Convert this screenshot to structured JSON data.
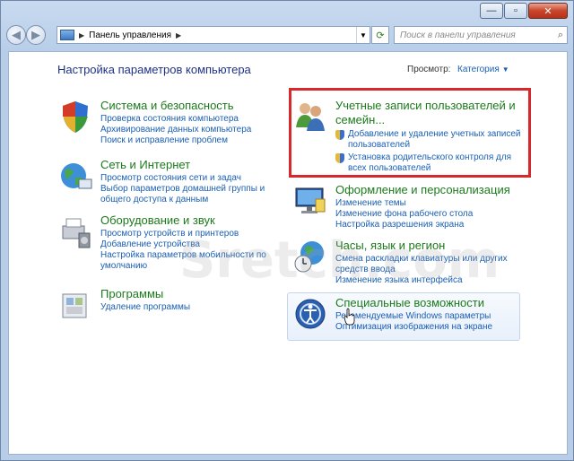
{
  "window": {
    "controls": {
      "minimize": "—",
      "maximize": "▫",
      "close": "✕"
    }
  },
  "navbar": {
    "breadcrumb": "Панель управления",
    "search_placeholder": "Поиск в панели управления"
  },
  "header": {
    "title": "Настройка параметров компьютера",
    "view_label": "Просмотр:",
    "view_value": "Категория"
  },
  "categories": {
    "system": {
      "title": "Система и безопасность",
      "links": [
        "Проверка состояния компьютера",
        "Архивирование данных компьютера",
        "Поиск и исправление проблем"
      ]
    },
    "network": {
      "title": "Сеть и Интернет",
      "links": [
        "Просмотр состояния сети и задач",
        "Выбор параметров домашней группы и",
        "общего доступа к данным"
      ]
    },
    "hardware": {
      "title": "Оборудование и звук",
      "links": [
        "Просмотр устройств и принтеров",
        "Добавление устройства",
        "Настройка параметров мобильности по",
        "умолчанию"
      ]
    },
    "programs": {
      "title": "Программы",
      "links": [
        "Удаление программы"
      ]
    },
    "accounts": {
      "title_line1": "Учетные записи пользователей и",
      "title_line2": "семейн...",
      "links": [
        "Добавление и удаление учетных записей",
        "пользователей",
        "Установка родительского контроля для",
        "всех пользователей"
      ]
    },
    "appearance": {
      "title": "Оформление и персонализация",
      "links": [
        "Изменение темы",
        "Изменение фона рабочего стола",
        "Настройка разрешения экрана"
      ]
    },
    "clock": {
      "title": "Часы, язык и регион",
      "links": [
        "Смена раскладки клавиатуры или других",
        "средств ввода",
        "Изменение языка интерфейса"
      ]
    },
    "access": {
      "title": "Специальные возможности",
      "links": [
        "Рекомендуемые Windows параметры",
        "Оптимизация изображения на экране"
      ]
    }
  },
  "watermark": "Sretch.com",
  "colors": {
    "title_green": "#1b7a1b",
    "link_blue": "#1a5fb4",
    "highlight_red": "#d7282b"
  }
}
